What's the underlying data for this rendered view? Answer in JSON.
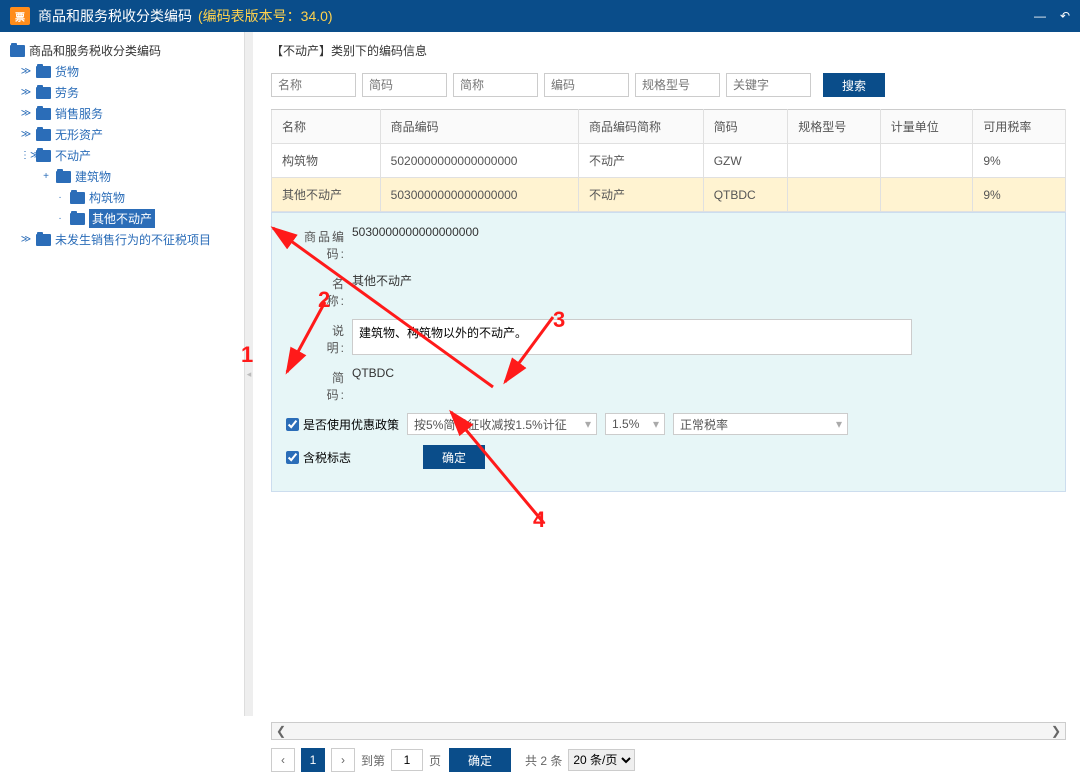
{
  "titlebar": {
    "logo_text": "票",
    "title": "商品和服务税收分类编码",
    "version": "(编码表版本号：34.0)"
  },
  "tree": {
    "root": "商品和服务税收分类编码",
    "items": [
      {
        "label": "货物",
        "indent": 14,
        "toggle": "≫"
      },
      {
        "label": "劳务",
        "indent": 14,
        "toggle": "≫"
      },
      {
        "label": "销售服务",
        "indent": 14,
        "toggle": "≫"
      },
      {
        "label": "无形资产",
        "indent": 14,
        "toggle": "≫"
      },
      {
        "label": "不动产",
        "indent": 14,
        "toggle": "⋮≫",
        "expanded": true
      },
      {
        "label": "建筑物",
        "indent": 34,
        "toggle": "+"
      },
      {
        "label": "构筑物",
        "indent": 48,
        "toggle": ""
      },
      {
        "label": "其他不动产",
        "indent": 48,
        "toggle": "",
        "selected": true
      },
      {
        "label": "未发生销售行为的不征税项目",
        "indent": 14,
        "toggle": "≫"
      }
    ]
  },
  "breadcrumb": "【不动产】类别下的编码信息",
  "filters": {
    "ph": [
      "名称",
      "简码",
      "简称",
      "编码",
      "规格型号",
      "关键字"
    ],
    "btn": "搜索"
  },
  "table": {
    "headers": [
      "名称",
      "商品编码",
      "商品编码简称",
      "简码",
      "规格型号",
      "计量单位",
      "可用税率"
    ],
    "rows": [
      {
        "c": [
          "构筑物",
          "5020000000000000000",
          "不动产",
          "GZW",
          "",
          "",
          "9%"
        ]
      },
      {
        "c": [
          "其他不动产",
          "5030000000000000000",
          "不动产",
          "QTBDC",
          "",
          "",
          "9%"
        ],
        "sel": true
      }
    ]
  },
  "detail": {
    "code_label": "商品编码:",
    "code": "5030000000000000000",
    "name_label": "名　　称:",
    "name": "其他不动产",
    "desc_label": "说　　明:",
    "desc": "建筑物、构筑物以外的不动产。",
    "short_label": "简　　码:",
    "short": "QTBDC",
    "policy_label": "是否使用优惠政策",
    "policy_sel": "按5%简易征收减按1.5%计征",
    "rate_sel": "1.5%",
    "normal_sel": "正常税率",
    "tax_flag": "含税标志",
    "ok": "确定"
  },
  "pager": {
    "cur": "1",
    "goto": "到第",
    "page": "页",
    "ok": "确定",
    "total": "共 2 条",
    "size": "20 条/页"
  },
  "annotations": {
    "n1": "1",
    "n2": "2",
    "n3": "3",
    "n4": "4"
  }
}
